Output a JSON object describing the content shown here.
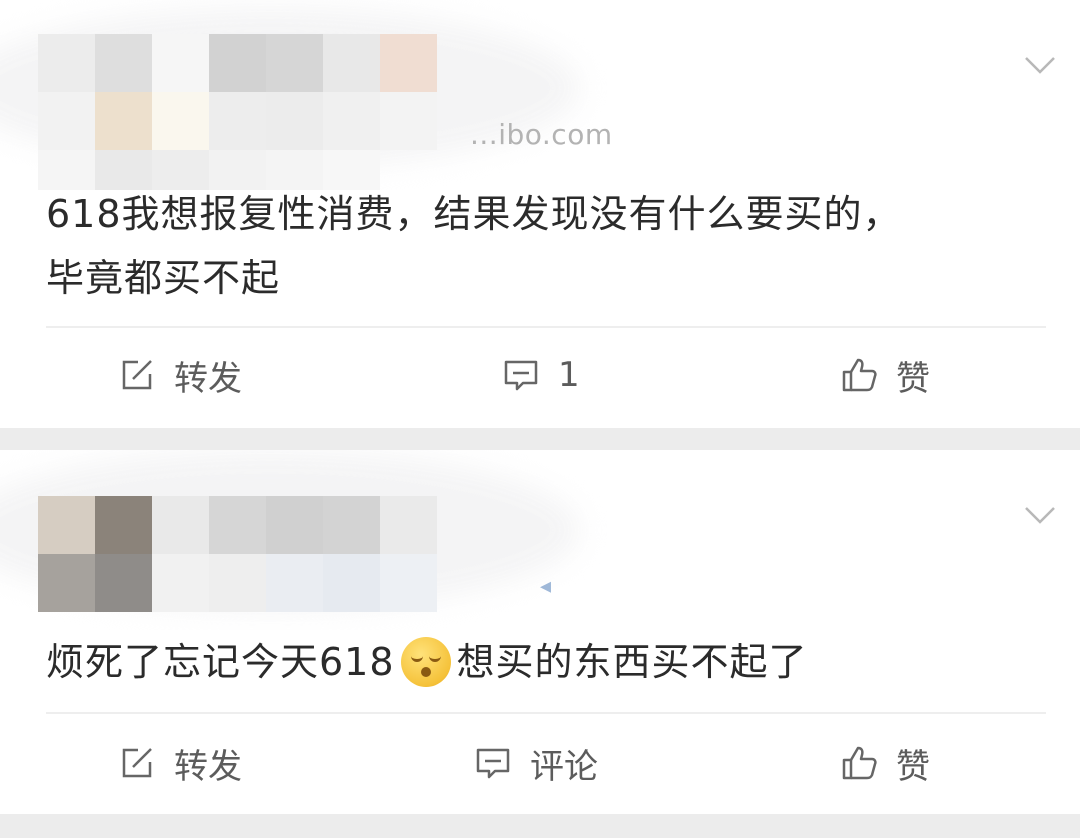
{
  "posts": [
    {
      "source": "...ibo.com",
      "text_line1": "618我想报复性消费，结果发现没有什么要买的，",
      "text_line2": "毕竟都买不起",
      "actions": {
        "repost": "转发",
        "comment": "1",
        "like": "赞"
      }
    },
    {
      "source": "◂",
      "text_before_emoji": "烦死了忘记今天618",
      "emoji": "face-emoji",
      "text_after_emoji": "想买的东西买不起了",
      "actions": {
        "repost": "转发",
        "comment": "评论",
        "like": "赞"
      }
    }
  ],
  "icons": {
    "more": "chevron-down-icon",
    "repost": "repost-icon",
    "comment": "comment-icon",
    "like": "thumbs-up-icon"
  },
  "colors": {
    "card_bg": "#ffffff",
    "gap_bg": "#ececec",
    "text": "#2b2b2b",
    "action_text": "#5c5c5c",
    "source_text": "#b3b3b3"
  }
}
